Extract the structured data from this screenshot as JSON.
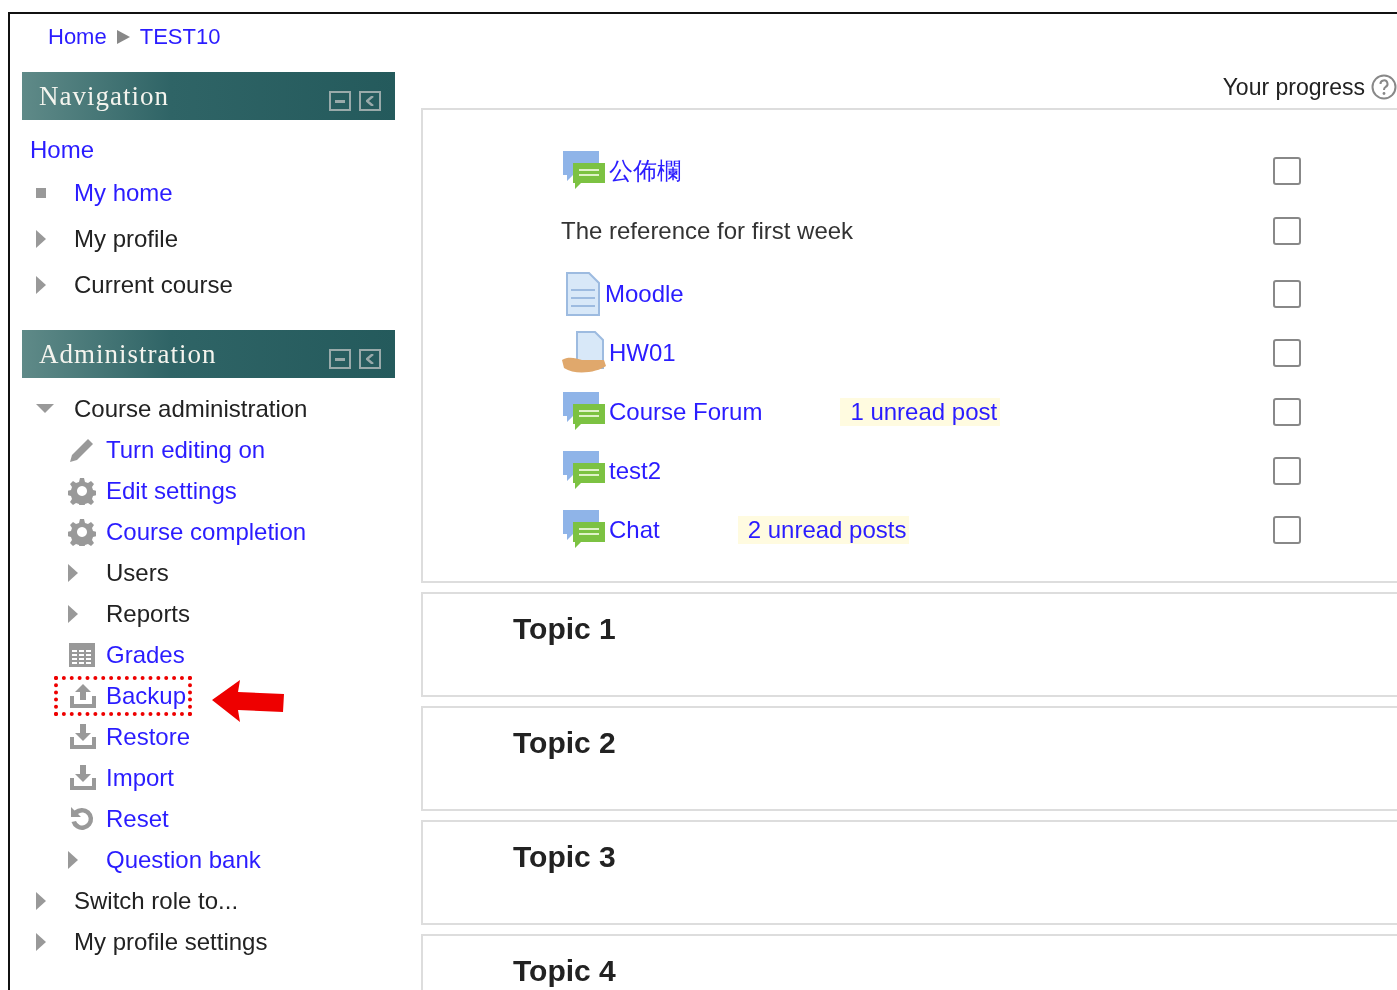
{
  "breadcrumb": [
    "Home",
    "TEST10"
  ],
  "navigation": {
    "title": "Navigation",
    "items": [
      {
        "label": "Home",
        "kind": "top",
        "link": true
      },
      {
        "label": "My home",
        "kind": "bullet",
        "link": true
      },
      {
        "label": "My profile",
        "kind": "branch",
        "expanded": false,
        "link": false
      },
      {
        "label": "Current course",
        "kind": "branch",
        "expanded": false,
        "link": false
      }
    ]
  },
  "administration": {
    "title": "Administration",
    "items": [
      {
        "label": "Course administration",
        "kind": "branch",
        "expanded": true,
        "link": false,
        "children": [
          {
            "label": "Turn editing on",
            "kind": "edit",
            "link": true
          },
          {
            "label": "Edit settings",
            "kind": "settings",
            "link": true
          },
          {
            "label": "Course completion",
            "kind": "settings",
            "link": true
          },
          {
            "label": "Users",
            "kind": "branch",
            "expanded": false,
            "link": false
          },
          {
            "label": "Reports",
            "kind": "branch",
            "expanded": false,
            "link": false
          },
          {
            "label": "Grades",
            "kind": "grades",
            "link": true
          },
          {
            "label": "Backup",
            "kind": "backup",
            "link": true,
            "annotated": true
          },
          {
            "label": "Restore",
            "kind": "restore",
            "link": true
          },
          {
            "label": "Import",
            "kind": "restore",
            "link": true
          },
          {
            "label": "Reset",
            "kind": "reset",
            "link": true
          },
          {
            "label": "Question bank",
            "kind": "branch",
            "expanded": false,
            "link": true
          }
        ]
      },
      {
        "label": "Switch role to...",
        "kind": "branch",
        "expanded": false,
        "link": false
      },
      {
        "label": "My profile settings",
        "kind": "branch",
        "expanded": false,
        "link": false
      }
    ]
  },
  "progress_label": "Your progress",
  "activities": [
    {
      "name": "公佈欄",
      "kind": "forum",
      "checked": false
    },
    {
      "name": "The reference for first week",
      "kind": "label",
      "checked": false
    },
    {
      "name": "Moodle",
      "kind": "page",
      "checked": false
    },
    {
      "name": "HW01",
      "kind": "assignment",
      "checked": false
    },
    {
      "name": "Course Forum",
      "kind": "forum",
      "unread": "1 unread post",
      "checked": false
    },
    {
      "name": "test2",
      "kind": "forum",
      "checked": false
    },
    {
      "name": "Chat",
      "kind": "forum",
      "unread": "2 unread posts",
      "checked": false
    }
  ],
  "topics": [
    "Topic 1",
    "Topic 2",
    "Topic 3",
    "Topic 4"
  ]
}
